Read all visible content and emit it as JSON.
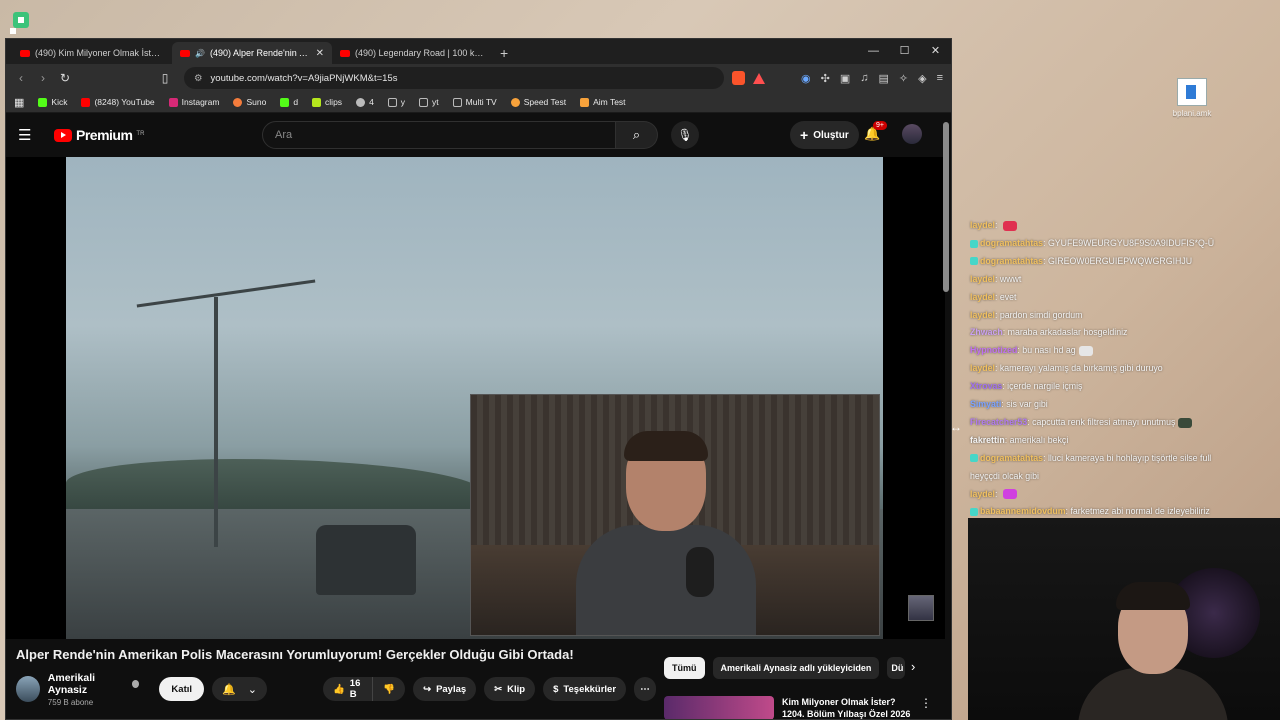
{
  "desktop": {
    "file_label": "bplani.amk"
  },
  "browser": {
    "tabs": [
      {
        "title": "(490) Kim Milyoner Olmak İster? 120",
        "active": false
      },
      {
        "title": "(490) Alper Rende'nin Amerik",
        "active": true
      },
      {
        "title": "(490) Legendary Road | 100 km/h - Y",
        "active": false
      }
    ],
    "url": "youtube.com/watch?v=A9jiaPNjWKM&t=15s",
    "bookmarks": [
      {
        "label": "Kick",
        "color": "#53fc18"
      },
      {
        "label": "(8248) YouTube",
        "color": "#ff0000"
      },
      {
        "label": "Instagram",
        "color": "#d62976"
      },
      {
        "label": "Suno",
        "color": "#f47c3c"
      },
      {
        "label": "d",
        "color": "#53fc18"
      },
      {
        "label": "clips",
        "color": "#b5e61d"
      },
      {
        "label": "4",
        "color": "#bbbbbb"
      },
      {
        "label": "y",
        "color": "#bbbbbb"
      },
      {
        "label": "yt",
        "color": "#bbbbbb"
      },
      {
        "label": "Multi TV",
        "color": "#bbbbbb"
      },
      {
        "label": "Speed Test",
        "color": "#f7a23b"
      },
      {
        "label": "Aim Test",
        "color": "#f7a23b"
      }
    ]
  },
  "youtube": {
    "logo_text": "Premium",
    "logo_region": "TR",
    "search_placeholder": "Ara",
    "create_label": "Oluştur",
    "notif_count": "9+",
    "video_title": "Alper Rende'nin Amerikan Polis Macerasını Yorumluyorum! Gerçekler Olduğu Gibi Ortada!",
    "channel_name": "Amerikali Aynasiz",
    "subscribers": "759 B abone",
    "join_label": "Katıl",
    "likes": "16 B",
    "share_label": "Paylaş",
    "clip_label": "Klip",
    "thanks_label": "Teşekkürler",
    "chips": [
      "Tümü",
      "Amerikali Aynasiz adlı yükleyiciden",
      "Dü"
    ],
    "rec_title_1": "Kim Milyoner Olmak İster?",
    "rec_title_2": "1204. Bölüm Yılbaşı Özel 2026"
  },
  "chat": [
    {
      "user": "laydel",
      "text": "",
      "color": "#f0c060",
      "emote": "#e03050"
    },
    {
      "user": "dogramatahtas",
      "text": "GYUFE9WEURGYU8F9S0A9IDUFIS*Q-Ü",
      "color": "#f0c060",
      "badge": "#46d6c8"
    },
    {
      "user": "dogramatahtas",
      "text": "GIREOW0ERGUIEPWQWGRGIHJU",
      "color": "#f0c060",
      "badge": "#46d6c8"
    },
    {
      "user": "laydel",
      "text": "wwwt",
      "color": "#f0c060"
    },
    {
      "user": "laydel",
      "text": "evet",
      "color": "#f0c060"
    },
    {
      "user": "laydel",
      "text": "pardon simdi gordum",
      "color": "#f0c060"
    },
    {
      "user": "Zhwach",
      "text": "maraba arkadaslar hosgeldiniz",
      "color": "#c9a0f0"
    },
    {
      "user": "Hypnotized",
      "text": "bu nası hd ag",
      "color": "#c070f0",
      "emote": "#e6e6e6"
    },
    {
      "user": "laydel",
      "text": "kamerayı yalamış da bırkamış gibi duruyo",
      "color": "#f0c060"
    },
    {
      "user": "Xtrovas",
      "text": "içerde nargile içmiş",
      "color": "#a070f0"
    },
    {
      "user": "Simyati",
      "text": "sis var gibi",
      "color": "#7aa2ff"
    },
    {
      "user": "Firecatcher53",
      "text": "capcutta renk filtresi atmayı unutmuş",
      "color": "#b07af0",
      "emote": "#3a4a3a"
    },
    {
      "user": "fakrettin",
      "text": "amerikalı bekçi",
      "color": "#f3f3f3"
    },
    {
      "user": "dogramatahtas",
      "text": "lluci kameraya bi hohlayıp tişörtle silse full",
      "color": "#f0c060",
      "badge": "#46d6c8"
    },
    {
      "user": "",
      "text": "heyççdi olcak gibi",
      "color": "#f3f3f3"
    },
    {
      "user": "laydel",
      "text": "",
      "color": "#f0c060",
      "emote": "#d040e0"
    },
    {
      "user": "babaannemidovdum",
      "text": "farketmez abi normal de izleyebiliriz",
      "color": "#f0c060",
      "badge": "#46d6c8"
    }
  ]
}
